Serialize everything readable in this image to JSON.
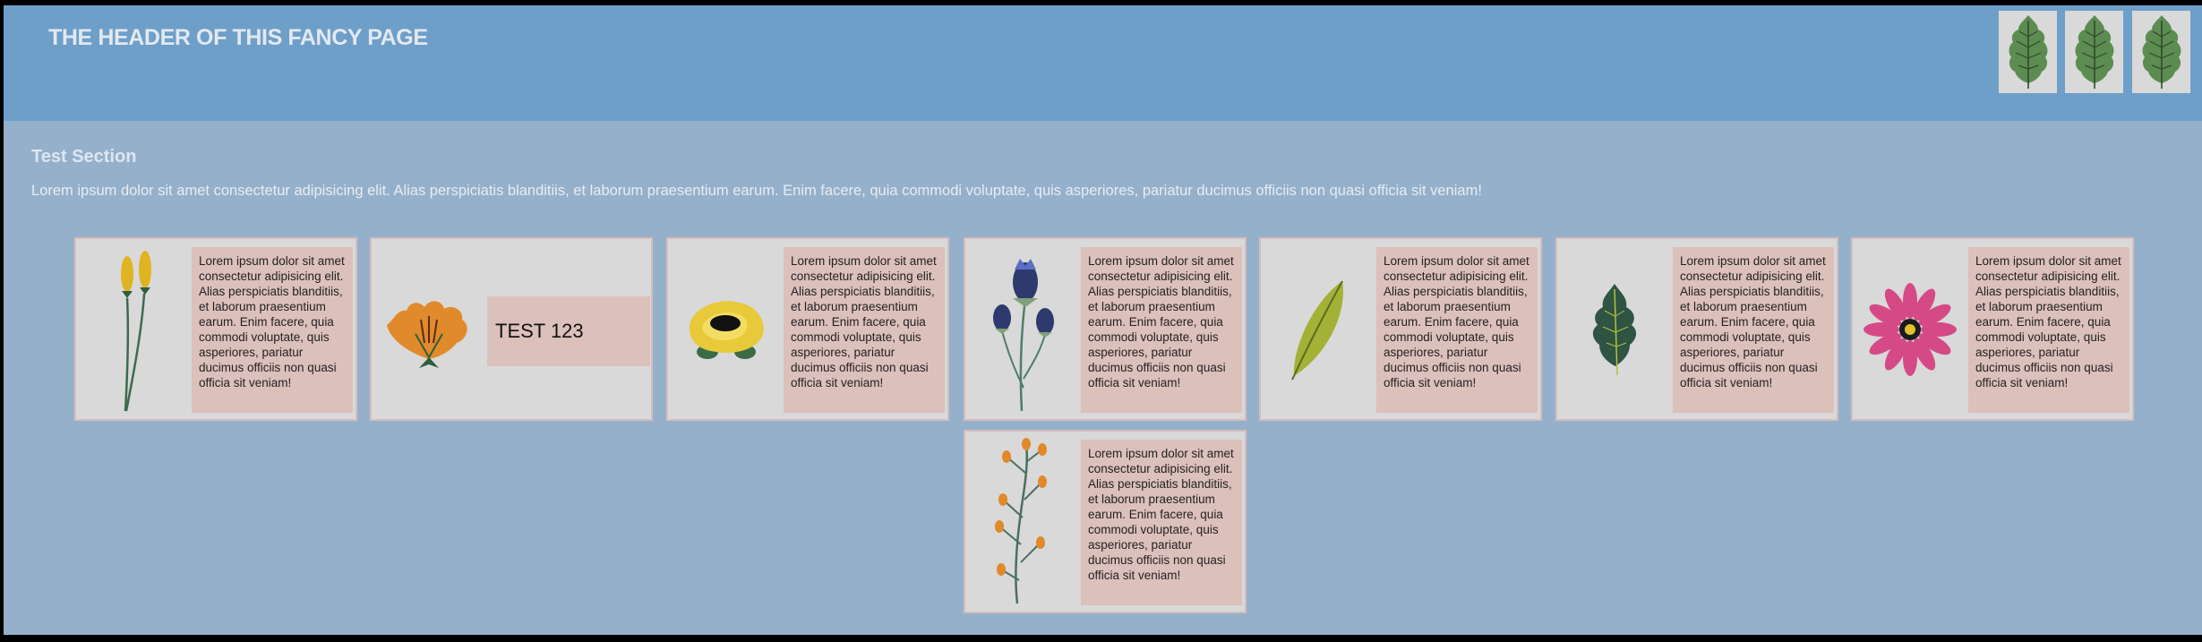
{
  "header": {
    "title": "THE HEADER OF THIS FANCY PAGE",
    "tiles": [
      {
        "icon": "leaf-icon"
      },
      {
        "icon": "leaf-icon"
      },
      {
        "icon": "leaf-icon"
      }
    ]
  },
  "section": {
    "title": "Test Section",
    "text": "Lorem ipsum dolor sit amet consectetur adipisicing elit. Alias perspiciatis blanditiis, et laborum praesentium earum. Enim facere, quia commodi voluptate, quis asperiores, pariatur ducimus officiis non quasi officia sit veniam!"
  },
  "cards": [
    {
      "icon": "tall-yellow-flowers-icon",
      "text": "Lorem ipsum dolor sit amet consectetur adipisicing elit. Alias perspiciatis blanditiis, et laborum praesentium earum. Enim facere, quia commodi voluptate, quis asperiores, pariatur ducimus officiis non quasi officia sit veniam!"
    },
    {
      "icon": "orange-flower-icon",
      "label": "TEST 123"
    },
    {
      "icon": "yellow-rose-icon",
      "text": "Lorem ipsum dolor sit amet consectetur adipisicing elit. Alias perspiciatis blanditiis, et laborum praesentium earum. Enim facere, quia commodi voluptate, quis asperiores, pariatur ducimus officiis non quasi officia sit veniam!"
    },
    {
      "icon": "blue-thistle-icon",
      "text": "Lorem ipsum dolor sit amet consectetur adipisicing elit. Alias perspiciatis blanditiis, et laborum praesentium earum. Enim facere, quia commodi voluptate, quis asperiores, pariatur ducimus officiis non quasi officia sit veniam!"
    },
    {
      "icon": "green-leaf-icon",
      "text": "Lorem ipsum dolor sit amet consectetur adipisicing elit. Alias perspiciatis blanditiis, et laborum praesentium earum. Enim facere, quia commodi voluptate, quis asperiores, pariatur ducimus officiis non quasi officia sit veniam!"
    },
    {
      "icon": "dark-leaf-icon",
      "text": "Lorem ipsum dolor sit amet consectetur adipisicing elit. Alias perspiciatis blanditiis, et laborum praesentium earum. Enim facere, quia commodi voluptate, quis asperiores, pariatur ducimus officiis non quasi officia sit veniam!"
    },
    {
      "icon": "pink-daisy-icon",
      "text": "Lorem ipsum dolor sit amet consectetur adipisicing elit. Alias perspiciatis blanditiis, et laborum praesentium earum. Enim facere, quia commodi voluptate, quis asperiores, pariatur ducimus officiis non quasi officia sit veniam!"
    },
    {
      "icon": "orange-berry-branch-icon",
      "text": "Lorem ipsum dolor sit amet consectetur adipisicing elit. Alias perspiciatis blanditiis, et laborum praesentium earum. Enim facere, quia commodi voluptate, quis asperiores, pariatur ducimus officiis non quasi officia sit veniam!"
    }
  ],
  "colors": {
    "header_bg": "#6e9fc9",
    "page_bg": "#95b0cb",
    "card_bg": "#d9d9d9",
    "text_box_bg": "#dcc0bb",
    "card_border": "#d6bebe"
  }
}
